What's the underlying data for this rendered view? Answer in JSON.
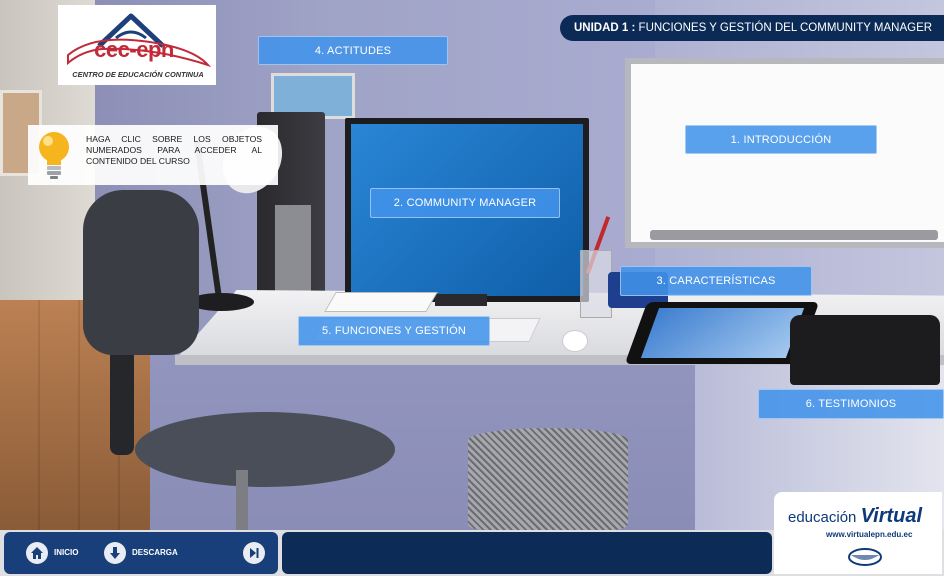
{
  "header": {
    "unit_prefix": "UNIDAD 1 :",
    "unit_title": "FUNCIONES Y GESTIÓN DEL COMMUNITY MANAGER"
  },
  "logo": {
    "name": "cec-epn",
    "subtitle": "CENTRO DE EDUCACIÓN CONTINUA"
  },
  "hint": {
    "text": "HAGA CLIC SOBRE LOS OBJETOS NUMERADOS PARA ACCEDER AL CONTENIDO DEL CURSO",
    "icon": "lightbulb-icon"
  },
  "hotspots": [
    {
      "label": "1. INTRODUCCIÓN"
    },
    {
      "label": "2. COMMUNITY MANAGER"
    },
    {
      "label": "3. CARACTERÍSTICAS"
    },
    {
      "label": "4. ACTITUDES"
    },
    {
      "label": "5. FUNCIONES Y GESTIÓN"
    },
    {
      "label": "6. TESTIMONIOS"
    }
  ],
  "footer": {
    "home_label": "INICIO",
    "download_label": "DESCARGA",
    "home_icon": "home-icon",
    "download_icon": "download-icon",
    "next_icon": "skip-next-icon"
  },
  "brand": {
    "prefix": "educación",
    "highlight": "Virtual",
    "url": "www.virtualepn.edu.ec"
  },
  "colors": {
    "header_bg": "#0b2a55",
    "hotspot_bg": "#4293eb",
    "logo_red": "#c22a3a",
    "nav_bg": "#183f79"
  }
}
